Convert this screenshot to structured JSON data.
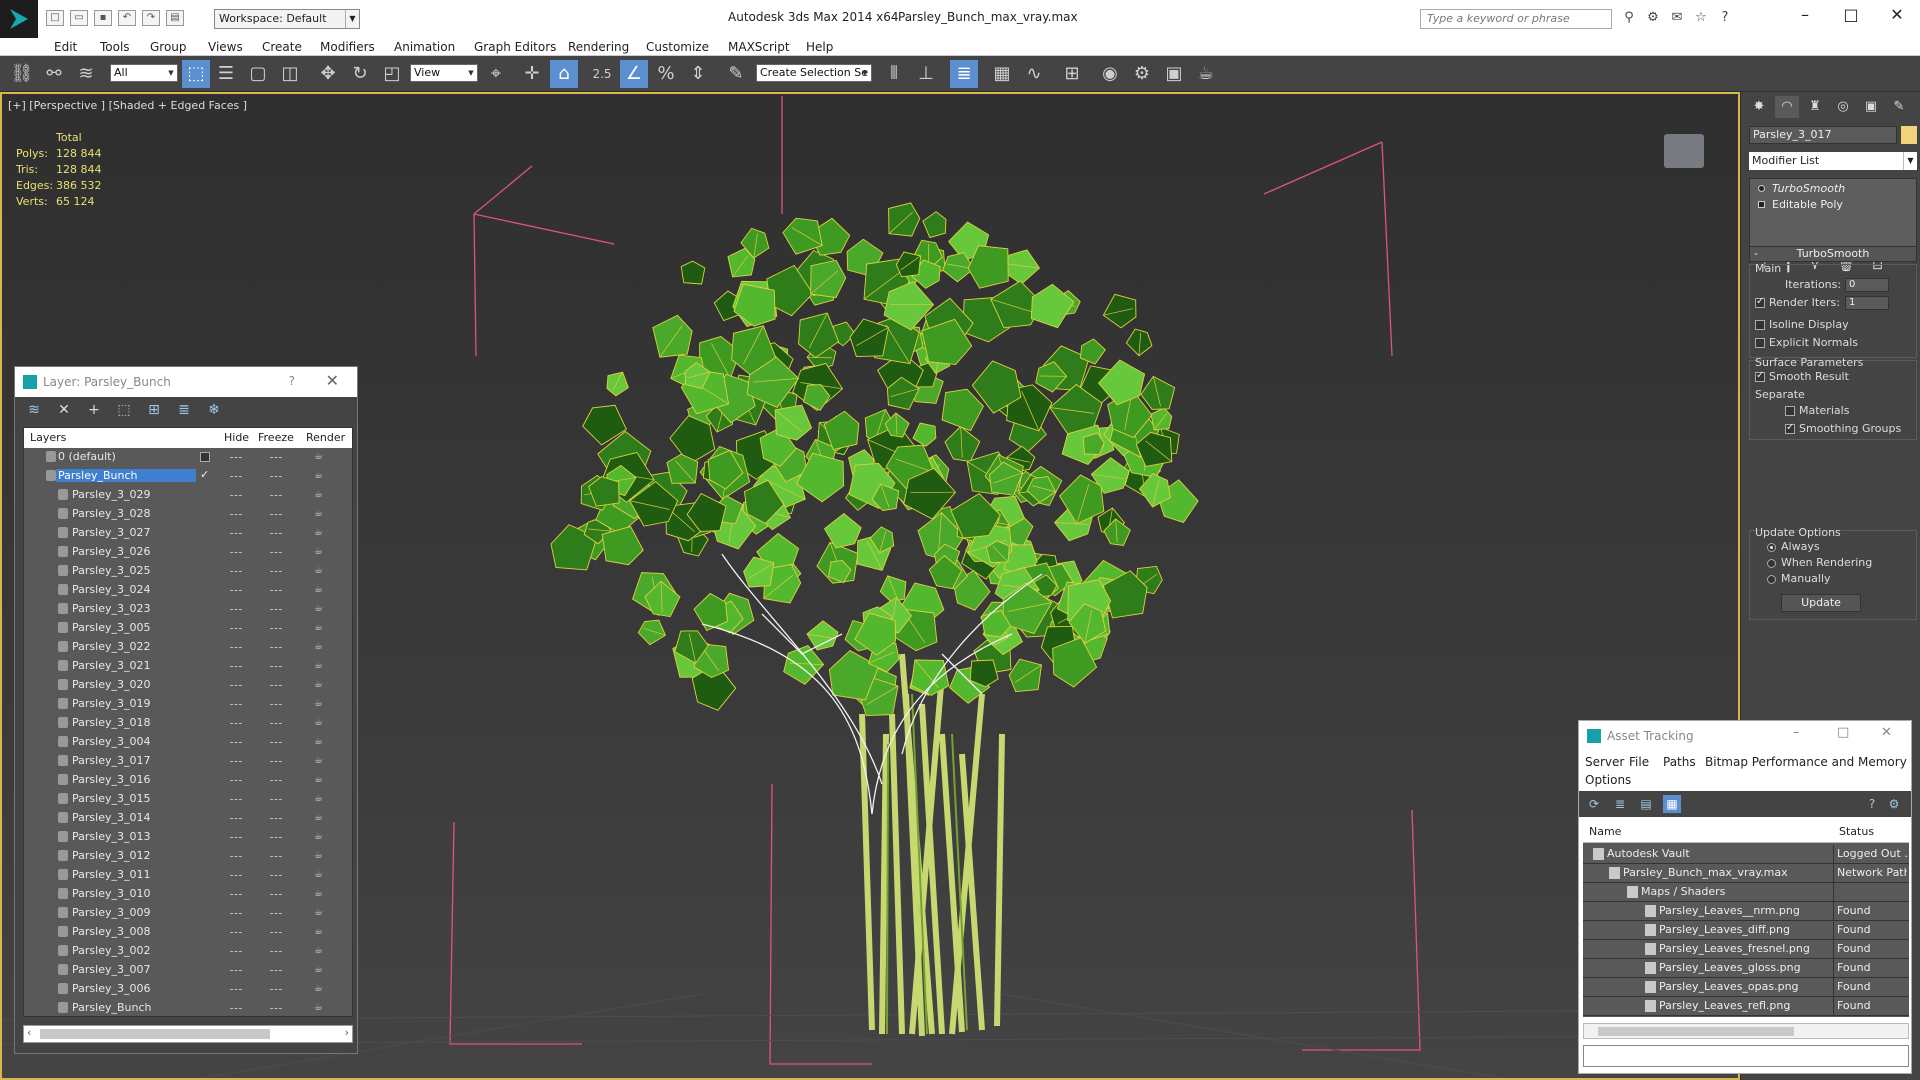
{
  "title_bar": {
    "workspace": "Workspace: Default",
    "app_name": "Autodesk 3ds Max  2014 x64",
    "file_name": "Parsley_Bunch_max_vray.max",
    "search_placeholder": "Type a keyword or phrase"
  },
  "menu": [
    "Edit",
    "Tools",
    "Group",
    "Views",
    "Create",
    "Modifiers",
    "Animation",
    "Graph Editors",
    "Rendering",
    "Customize",
    "MAXScript",
    "Help"
  ],
  "toolbar": {
    "selection_filter": "All",
    "reference_coord": "View",
    "named_selection": "Create Selection Se",
    "snap_label": "2.5"
  },
  "viewport": {
    "label": "[+] [Perspective ] [Shaded + Edged Faces ]",
    "stats": {
      "header": "Total",
      "rows": [
        {
          "k": "Polys:",
          "v": "128 844"
        },
        {
          "k": "Tris:",
          "v": "128 844"
        },
        {
          "k": "Edges:",
          "v": "386 532"
        },
        {
          "k": "Verts:",
          "v": "65 124"
        }
      ]
    }
  },
  "layer_dialog": {
    "title": "Layer: Parsley_Bunch",
    "help": "?",
    "columns": {
      "layers": "Layers",
      "hide": "Hide",
      "freeze": "Freeze",
      "render": "Render"
    },
    "default_layer": "0 (default)",
    "active_layer": "Parsley_Bunch",
    "objects": [
      "Parsley_3_029",
      "Parsley_3_028",
      "Parsley_3_027",
      "Parsley_3_026",
      "Parsley_3_025",
      "Parsley_3_024",
      "Parsley_3_023",
      "Parsley_3_005",
      "Parsley_3_022",
      "Parsley_3_021",
      "Parsley_3_020",
      "Parsley_3_019",
      "Parsley_3_018",
      "Parsley_3_004",
      "Parsley_3_017",
      "Parsley_3_016",
      "Parsley_3_015",
      "Parsley_3_014",
      "Parsley_3_013",
      "Parsley_3_012",
      "Parsley_3_011",
      "Parsley_3_010",
      "Parsley_3_009",
      "Parsley_3_008",
      "Parsley_3_002",
      "Parsley_3_007",
      "Parsley_3_006",
      "Parsley_Bunch"
    ]
  },
  "command_panel": {
    "object_name": "Parsley_3_017",
    "object_color": "#f2d27a",
    "modifier_list": "Modifier List",
    "stack": [
      "TurboSmooth",
      "Editable Poly"
    ],
    "rollout_title": "TurboSmooth",
    "main_label": "Main",
    "iterations_label": "Iterations:",
    "iterations_value": "0",
    "render_iters_label": "Render Iters:",
    "render_iters_value": "1",
    "isoline": "Isoline Display",
    "explicit_normals": "Explicit Normals",
    "surface_params": "Surface Parameters",
    "smooth_result": "Smooth Result",
    "separate": "Separate",
    "materials": "Materials",
    "smoothing_groups": "Smoothing Groups",
    "update_options": "Update Options",
    "always": "Always",
    "when_rendering": "When Rendering",
    "manually": "Manually",
    "update_btn": "Update"
  },
  "asset_tracking": {
    "title": "Asset Tracking",
    "menu": [
      "Server",
      "File",
      "Paths",
      "Bitmap Performance and Memory",
      "Options"
    ],
    "columns": {
      "name": "Name",
      "status": "Status"
    },
    "rows": [
      {
        "name": "Autodesk Vault",
        "status": "Logged Out ..."
      },
      {
        "name": "Parsley_Bunch_max_vray.max",
        "status": "Network Path"
      },
      {
        "name": "Maps / Shaders",
        "status": ""
      },
      {
        "name": "Parsley_Leaves__nrm.png",
        "status": "Found"
      },
      {
        "name": "Parsley_Leaves_diff.png",
        "status": "Found"
      },
      {
        "name": "Parsley_Leaves_fresnel.png",
        "status": "Found"
      },
      {
        "name": "Parsley_Leaves_gloss.png",
        "status": "Found"
      },
      {
        "name": "Parsley_Leaves_opas.png",
        "status": "Found"
      },
      {
        "name": "Parsley_Leaves_refl.png",
        "status": "Found"
      }
    ]
  },
  "colors": {
    "accent": "#5b8fd0",
    "selection": "#3f7fcf",
    "stats_text": "#e8e070",
    "bbox": "#e0508a",
    "leaf_green": "#4aa82a",
    "wire_yellow": "#e0d040"
  }
}
